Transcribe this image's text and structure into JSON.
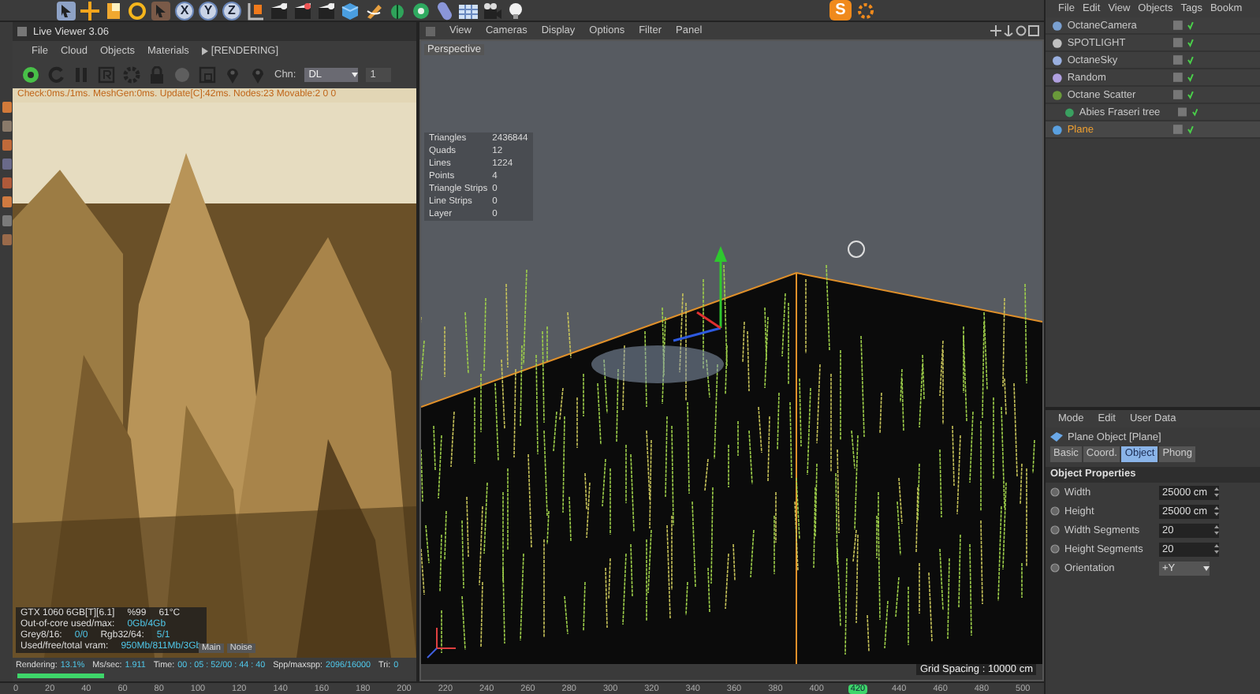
{
  "toolbar": {
    "axis_buttons": [
      "X",
      "Y",
      "Z"
    ],
    "logo": "S"
  },
  "live_viewer": {
    "title": "Live Viewer 3.06",
    "menu": [
      "File",
      "Cloud",
      "Objects",
      "Materials"
    ],
    "status_tag": "[RENDERING]",
    "channel_label": "Chn:",
    "channel": "DL",
    "spinner": "1",
    "check_line": "Check:0ms./1ms. MeshGen:0ms. Update[C]:42ms. Nodes:23 Movable:2 0 0",
    "overlay": [
      [
        {
          "text": "GTX 1060 6GB[T][6.1]",
          "kind": "label"
        },
        {
          "text": "%99",
          "kind": "label"
        },
        {
          "text": "61°C",
          "kind": "label"
        }
      ],
      [
        {
          "text": "Out-of-core used/max:",
          "kind": "label"
        },
        {
          "text": "0Gb/4Gb",
          "kind": "value"
        }
      ],
      [
        {
          "text": "Grey8/16:",
          "kind": "label"
        },
        {
          "text": "0/0",
          "kind": "value"
        },
        {
          "text": "Rgb32/64:",
          "kind": "label"
        },
        {
          "text": "5/1",
          "kind": "value"
        }
      ],
      [
        {
          "text": "Used/free/total vram:",
          "kind": "label"
        },
        {
          "text": "950Mb/811Mb/3Gb",
          "kind": "value"
        }
      ]
    ],
    "buffer_tabs": [
      "Main",
      "Noise"
    ],
    "stats_line": [
      {
        "label": "Rendering:",
        "value": "13.1%"
      },
      {
        "label": "Ms/sec:",
        "value": "1.911"
      },
      {
        "label": "Time:",
        "value": "00 : 05 : 52/00 : 44 : 40"
      },
      {
        "label": "Spp/maxspp:",
        "value": "2096/16000"
      },
      {
        "label": "Tri:",
        "value": "0"
      }
    ],
    "progress": {
      "level": 0.22
    }
  },
  "viewport": {
    "menu": [
      "View",
      "Cameras",
      "Display",
      "Options",
      "Filter",
      "Panel"
    ],
    "camera": "Perspective",
    "stats": [
      {
        "label": "Triangles",
        "value": "2436844"
      },
      {
        "label": "Quads",
        "value": "12"
      },
      {
        "label": "Lines",
        "value": "1224"
      },
      {
        "label": "Points",
        "value": "4"
      },
      {
        "label": "Triangle Strips",
        "value": "0"
      },
      {
        "label": "Line Strips",
        "value": "0"
      },
      {
        "label": "Layer",
        "value": "0"
      }
    ],
    "grid_spacing": "Grid Spacing : 10000 cm"
  },
  "object_manager": {
    "menu": [
      "File",
      "Edit",
      "View",
      "Objects",
      "Tags",
      "Bookm"
    ],
    "objects": [
      {
        "name": "OctaneCamera",
        "selected": false,
        "enabled": true
      },
      {
        "name": "SPOTLIGHT",
        "selected": false,
        "enabled": true
      },
      {
        "name": "OctaneSky",
        "selected": false,
        "enabled": true
      },
      {
        "name": "Random",
        "selected": false,
        "enabled": true
      },
      {
        "name": "Octane Scatter",
        "selected": false,
        "enabled": true,
        "children": [
          {
            "name": "Abies Fraseri tree",
            "selected": false,
            "enabled": true
          }
        ]
      },
      {
        "name": "Plane",
        "selected": true,
        "enabled": true
      }
    ]
  },
  "attributes": {
    "menu": [
      "Mode",
      "Edit",
      "User Data"
    ],
    "object_title": "Plane Object [Plane]",
    "tabs": [
      {
        "label": "Basic",
        "selected": false
      },
      {
        "label": "Coord.",
        "selected": false
      },
      {
        "label": "Object",
        "selected": true
      },
      {
        "label": "Phong",
        "selected": false
      }
    ],
    "section": "Object Properties",
    "fields": [
      {
        "label": "Width",
        "value": "25000 cm",
        "kind": "spinner"
      },
      {
        "label": "Height",
        "value": "25000 cm",
        "kind": "spinner"
      },
      {
        "label": "Width Segments",
        "value": "20",
        "kind": "spinner"
      },
      {
        "label": "Height Segments",
        "value": "20",
        "kind": "spinner"
      },
      {
        "label": "Orientation",
        "value": "+Y",
        "kind": "dropdown"
      }
    ]
  },
  "timeline": {
    "ticks": [
      {
        "label": "0",
        "selected": false
      },
      {
        "label": "20",
        "selected": false
      },
      {
        "label": "40",
        "selected": false
      },
      {
        "label": "60",
        "selected": false
      },
      {
        "label": "80",
        "selected": false
      },
      {
        "label": "100",
        "selected": false
      },
      {
        "label": "120",
        "selected": false
      },
      {
        "label": "140",
        "selected": false
      },
      {
        "label": "160",
        "selected": false
      },
      {
        "label": "180",
        "selected": false
      },
      {
        "label": "200",
        "selected": false
      },
      {
        "label": "220",
        "selected": false
      },
      {
        "label": "240",
        "selected": false
      },
      {
        "label": "260",
        "selected": false
      },
      {
        "label": "280",
        "selected": false
      },
      {
        "label": "300",
        "selected": false
      },
      {
        "label": "320",
        "selected": false
      },
      {
        "label": "340",
        "selected": false
      },
      {
        "label": "360",
        "selected": false
      },
      {
        "label": "380",
        "selected": false
      },
      {
        "label": "400",
        "selected": false
      },
      {
        "label": "420",
        "selected": true
      },
      {
        "label": "440",
        "selected": false
      },
      {
        "label": "460",
        "selected": false
      },
      {
        "label": "480",
        "selected": false
      },
      {
        "label": "500",
        "selected": false
      }
    ]
  }
}
